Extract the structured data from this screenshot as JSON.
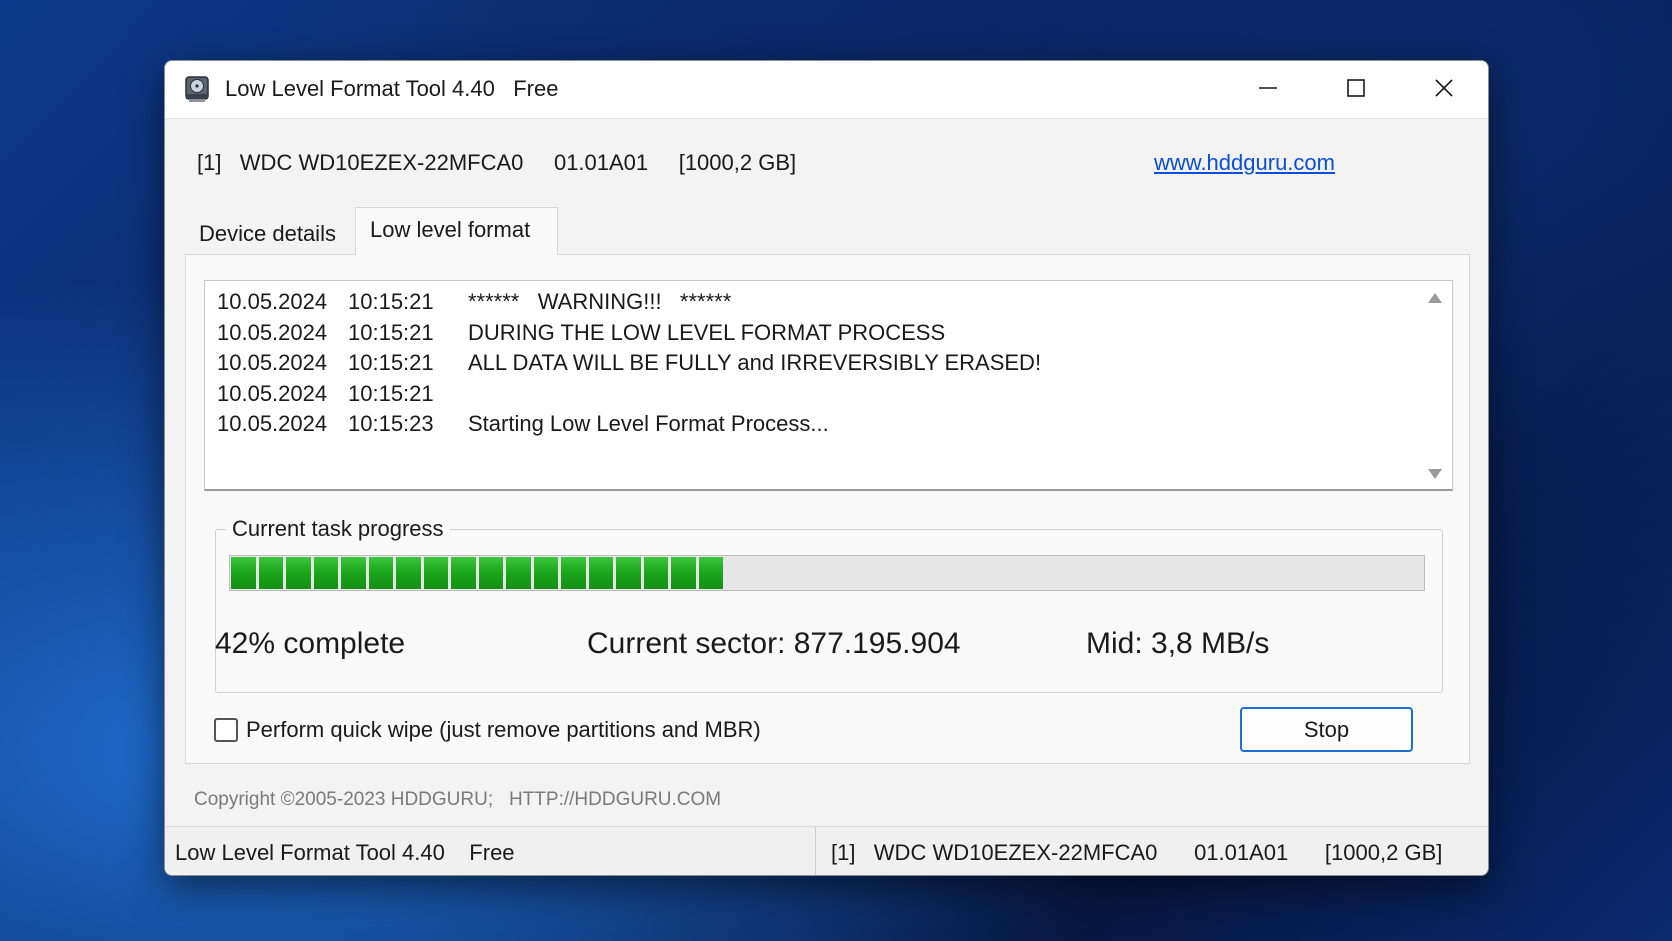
{
  "window": {
    "title": "Low Level Format Tool 4.40   Free",
    "icon": "hard-drive-icon",
    "controls": [
      "minimize-icon",
      "maximize-icon",
      "close-icon"
    ]
  },
  "device": {
    "line": "[1]   WDC WD10EZEX-22MFCA0     01.01A01     [1000,2 GB]",
    "link": "www.hddguru.com"
  },
  "tabs": [
    {
      "label": "Device details",
      "active": false
    },
    {
      "label": "Low level format",
      "active": true
    }
  ],
  "log": [
    {
      "date": "10.05.2024",
      "time": "10:15:21",
      "message": "******   WARNING!!!   ******"
    },
    {
      "date": "10.05.2024",
      "time": "10:15:21",
      "message": "DURING THE LOW LEVEL FORMAT PROCESS"
    },
    {
      "date": "10.05.2024",
      "time": "10:15:21",
      "message": "ALL DATA WILL BE FULLY and IRREVERSIBLY ERASED!"
    },
    {
      "date": "10.05.2024",
      "time": "10:15:21",
      "message": ""
    },
    {
      "date": "10.05.2024",
      "time": "10:15:23",
      "message": "Starting Low Level Format Process..."
    }
  ],
  "progress": {
    "group_label": "Current task progress",
    "percent": 42,
    "complete_text": "42% complete",
    "sector_text": "Current sector: 877.195.904",
    "speed_text": "Mid: 3,8 MB/s",
    "color": "#1aa51a"
  },
  "options": {
    "quick_wipe_label": "Perform quick wipe (just remove partitions and MBR)",
    "quick_wipe_checked": false,
    "stop_label": "Stop"
  },
  "footer": {
    "copyright": "Copyright ©2005-2023 HDDGURU;   HTTP://HDDGURU.COM",
    "status_left": "Low Level Format Tool 4.40    Free",
    "status_right": "[1]   WDC WD10EZEX-22MFCA0      01.01A01      [1000,2 GB]"
  }
}
